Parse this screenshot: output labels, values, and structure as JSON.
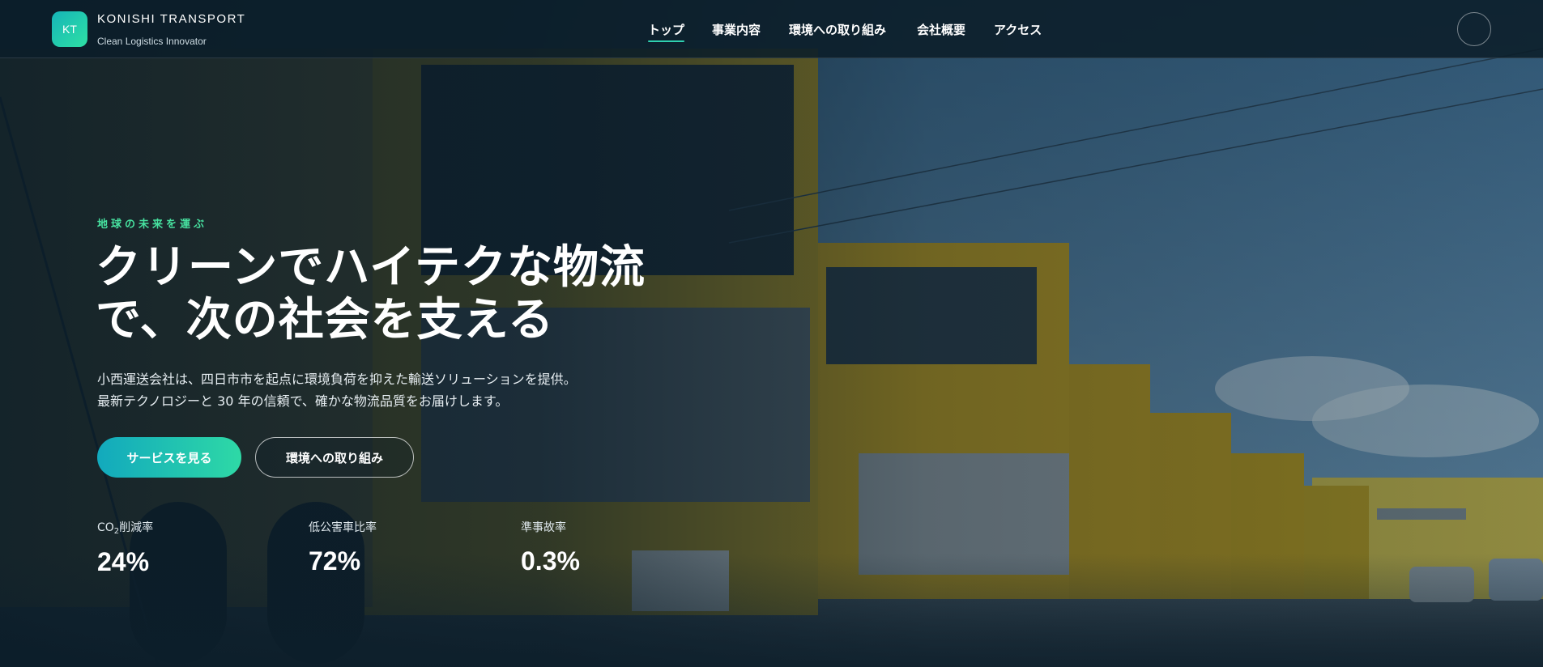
{
  "brand": {
    "logo_initials": "KT",
    "name": "KONISHI TRANSPORT",
    "tagline": "Clean Logistics Innovator"
  },
  "nav": {
    "items": [
      {
        "label": "トップ",
        "active": true
      },
      {
        "label": "事業内容",
        "active": false
      },
      {
        "label": "環境への取り組み",
        "active": false
      },
      {
        "label": "会社概要",
        "active": false
      },
      {
        "label": "アクセス",
        "active": false
      }
    ],
    "menu_icon": "menu-circle-icon"
  },
  "hero": {
    "eyebrow": "地球の未来を運ぶ",
    "headline_line1": "クリーンでハイテクな物流",
    "headline_line2": "で、次の社会を支える",
    "lead_line1": "小西運送会社は、四日市市を起点に環境負荷を抑えた輸送ソリューションを提供。",
    "lead_line2": "最新テクノロジーと 30 年の信頼で、確かな物流品質をお届けします。",
    "primary_button": "サービスを見る",
    "secondary_button": "環境への取り組み"
  },
  "stats": [
    {
      "label_main": "CO",
      "label_sub": "2",
      "label_rest": "削減率",
      "value": "24%"
    },
    {
      "label": "低公害車比率",
      "value": "72%"
    },
    {
      "label": "準事故率",
      "value": "0.3%"
    }
  ],
  "colors": {
    "accent_green": "#47e2a0",
    "accent_teal": "#12a9bd",
    "header_bg": "#0b1e29"
  }
}
